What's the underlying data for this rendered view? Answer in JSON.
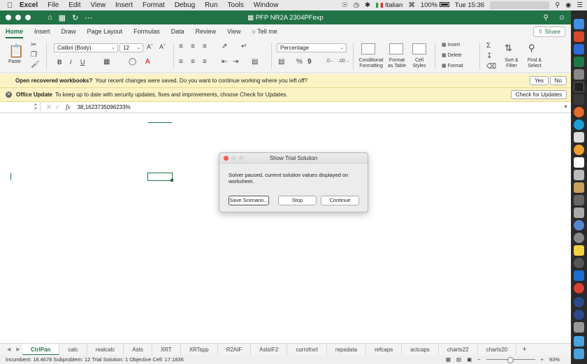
{
  "menubar": {
    "app": "Excel",
    "items": [
      "File",
      "Edit",
      "View",
      "Insert",
      "Format",
      "Debug",
      "Run",
      "Tools",
      "Window"
    ],
    "input_source": "Italian",
    "battery": "100%",
    "clock": "Tue 15:36"
  },
  "window": {
    "title": "PFP NR2A 2304PFexp"
  },
  "ribbon": {
    "tabs": [
      "Home",
      "Insert",
      "Draw",
      "Page Layout",
      "Formulas",
      "Data",
      "Review",
      "View"
    ],
    "tell_me": "Tell me",
    "share": "Share",
    "paste_label": "Paste",
    "font_name": "Calibri (Body)",
    "font_size": "12",
    "number_format": "Percentage",
    "conditional": [
      "Conditional",
      "Formatting"
    ],
    "format_table": [
      "Format",
      "as Table"
    ],
    "cell_styles": [
      "Cell",
      "Styles"
    ],
    "insert": "Insert",
    "delete": "Delete",
    "format": "Format",
    "sort": [
      "Sort &",
      "Filter"
    ],
    "find": [
      "Find &",
      "Select"
    ]
  },
  "notices": {
    "recover_bold": "Open recovered workbooks?",
    "recover_text": "Your recent changes were saved. Do you want to continue working where you left off?",
    "yes": "Yes",
    "no": "No",
    "update_bold": "Office Update",
    "update_text": "To keep up to date with security updates, fixes and improvements, choose Check for Updates.",
    "check": "Check for Updates"
  },
  "formula_bar": {
    "value": "38,16237350962​33%"
  },
  "dialog": {
    "title": "Show Trial Solution",
    "message_line1": "Solver paused, current solution values displayed on",
    "message_line2": "worksheet.",
    "save_scenario": "Save Scenario...",
    "stop": "Stop",
    "continue": "Continue"
  },
  "sheet_tabs": [
    "CtrlPan",
    "calc",
    "realcalc",
    "Asts",
    "XRT",
    "XRTspp",
    "R2AIF",
    "AstsIF2",
    "currsfrxrt",
    "repsdata",
    "refcaps",
    "actcaps",
    "charts22",
    "charts20"
  ],
  "active_sheet": "CtrlPan",
  "status": {
    "text": "Incumbent: 18.4678  Subproblem: 12  Trial Solution: 1  Objective Cell: 17.1836",
    "zoom": "93%"
  },
  "colors": {
    "excel_green": "#217346",
    "notice_bg": "#fcf3c5",
    "dock_bg": "#2a2a2a"
  }
}
